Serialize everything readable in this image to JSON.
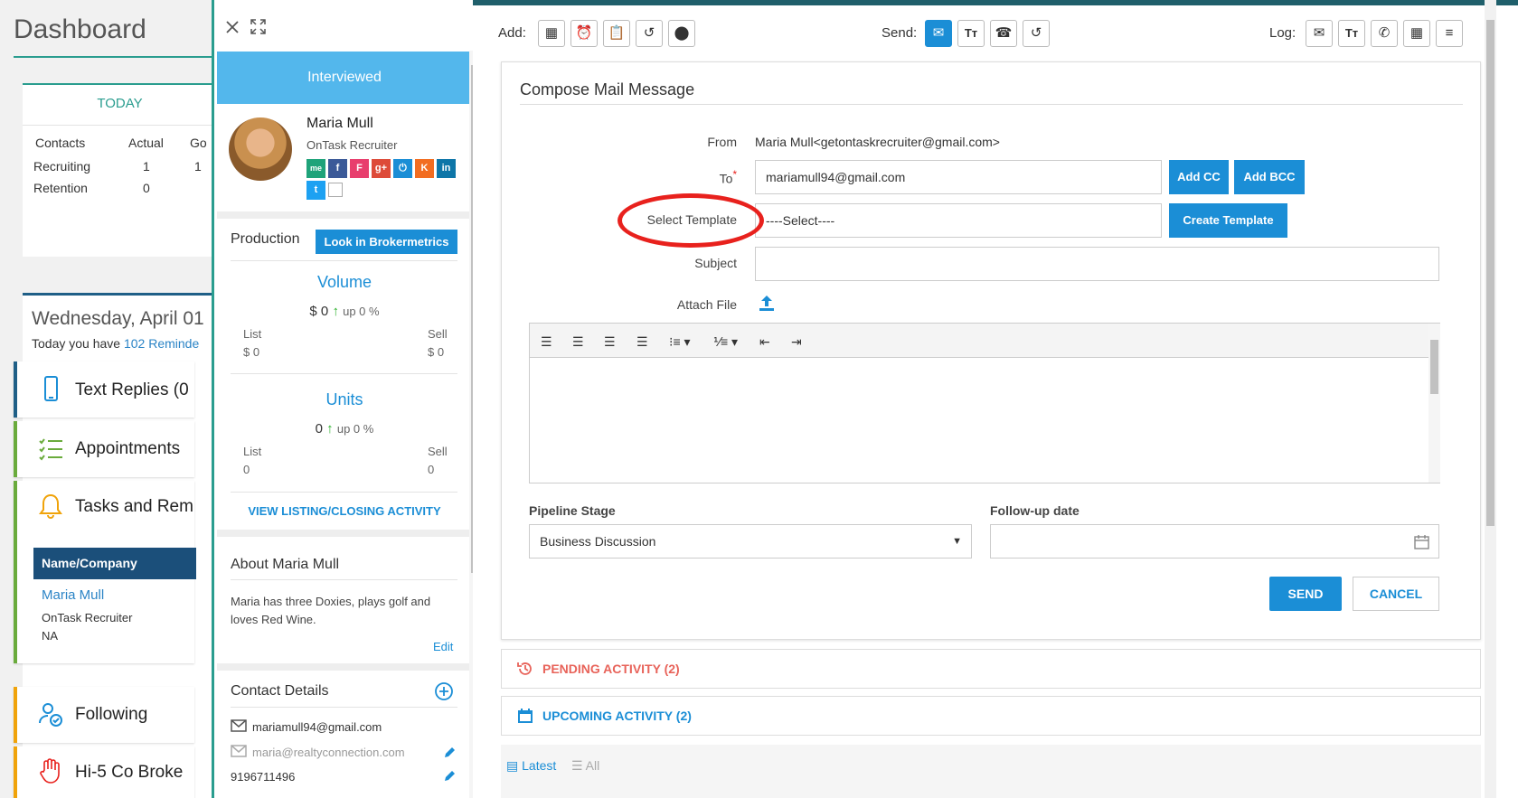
{
  "dashboard": {
    "title": "Dashboard",
    "today": {
      "heading": "TODAY",
      "columns": [
        "Contacts",
        "Actual",
        "Go"
      ],
      "rows": [
        {
          "label": "Recruiting",
          "actual": "1",
          "goal": "1"
        },
        {
          "label": "Retention",
          "actual": "0",
          "goal": ""
        }
      ]
    },
    "date": "Wednesday, April 01",
    "reminder_prefix": "Today you have ",
    "reminder_link": "102 Reminde",
    "blocks": [
      {
        "label": "Text Replies (0",
        "icon": "phone-icon",
        "color": "#1f5f87"
      },
      {
        "label": "Appointments",
        "icon": "checklist-icon",
        "color": "#6aab3c"
      },
      {
        "label": "Tasks and Rem",
        "icon": "bell-icon",
        "color": "#6aab3c"
      },
      {
        "label": "Following",
        "icon": "following-icon",
        "color": "#f0a30a"
      },
      {
        "label": "Hi-5 Co Broke",
        "icon": "hand-icon",
        "color": "#f0a30a"
      }
    ],
    "tasks_table": {
      "header": "Name/Company",
      "name": "Maria Mull",
      "company": "OnTask Recruiter",
      "region": "NA"
    }
  },
  "panel": {
    "status": "Interviewed",
    "contact_name": "Maria Mull",
    "contact_title": "OnTask Recruiter",
    "social": [
      "me",
      "f",
      "F",
      "g+",
      "⏻",
      "K",
      "in",
      "t"
    ],
    "production_label": "Production",
    "brokermetrics_button": "Look in Brokermetrics",
    "volume": {
      "title": "Volume",
      "value": "$ 0",
      "change": "up 0 %",
      "list_label": "List",
      "list_value": "$ 0",
      "sell_label": "Sell",
      "sell_value": "$ 0"
    },
    "units": {
      "title": "Units",
      "value": "0",
      "change": "up 0 %",
      "list_label": "List",
      "list_value": "0",
      "sell_label": "Sell",
      "sell_value": "0"
    },
    "activity_link": "VIEW LISTING/CLOSING ACTIVITY",
    "about_title": "About Maria Mull",
    "about_text": "Maria has three Doxies, plays golf and loves Red Wine.",
    "edit_link": "Edit",
    "contact_details_title": "Contact Details",
    "email_primary": "mariamull94@gmail.com",
    "email_secondary": "maria@realtyconnection.com",
    "phone": "9196711496"
  },
  "toolbar": {
    "add_label": "Add:",
    "send_label": "Send:",
    "log_label": "Log:"
  },
  "compose": {
    "title": "Compose Mail Message",
    "from_label": "From",
    "from_value": "Maria Mull<getontaskrecruiter@gmail.com>",
    "to_label": "To",
    "to_value": "mariamull94@gmail.com",
    "add_cc": "Add CC",
    "add_bcc": "Add BCC",
    "template_label": "Select Template",
    "template_value": "----Select----",
    "create_template": "Create Template",
    "subject_label": "Subject",
    "subject_value": "",
    "attach_label": "Attach File",
    "pipeline_label": "Pipeline Stage",
    "pipeline_value": "Business Discussion",
    "followup_label": "Follow-up date",
    "followup_value": "",
    "send_button": "SEND",
    "cancel_button": "CANCEL"
  },
  "activity": {
    "pending": "PENDING ACTIVITY (2)",
    "upcoming": "UPCOMING ACTIVITY (2)",
    "tab_latest": "Latest",
    "tab_all": "All"
  },
  "colors": {
    "accent": "#1b8ed6",
    "teal": "#2a9d8f",
    "status_bar": "#53b7ec",
    "pending": "#e8635a",
    "annotation": "#e8211d"
  }
}
